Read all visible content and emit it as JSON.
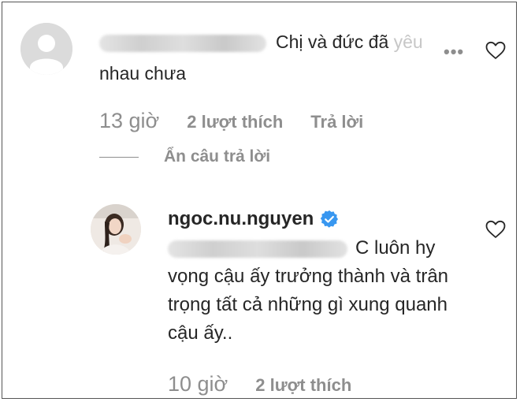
{
  "comment": {
    "text_visible": "Chị và đức đã",
    "text_faded": "yêu",
    "text_line2": "nhau chưa",
    "time": "13 giờ",
    "likes": "2 lượt thích",
    "reply": "Trả lời",
    "hide_replies": "Ẩn câu trả lời"
  },
  "reply_comment": {
    "username": "ngoc.nu.nguyen",
    "text_line1": "C luôn hy",
    "text_rest": "vọng cậu ấy trưởng thành và trân trọng tất cả những gì xung quanh cậu ấy..",
    "time": "10 giờ",
    "likes": "2 lượt thích"
  },
  "colors": {
    "text": "#262626",
    "muted": "#8e8e8e",
    "verified": "#3897f0",
    "avatar_placeholder": "#dbdbdb"
  },
  "icons": [
    "default-avatar-icon",
    "more-options-icon",
    "heart-icon",
    "verified-badge-icon"
  ]
}
